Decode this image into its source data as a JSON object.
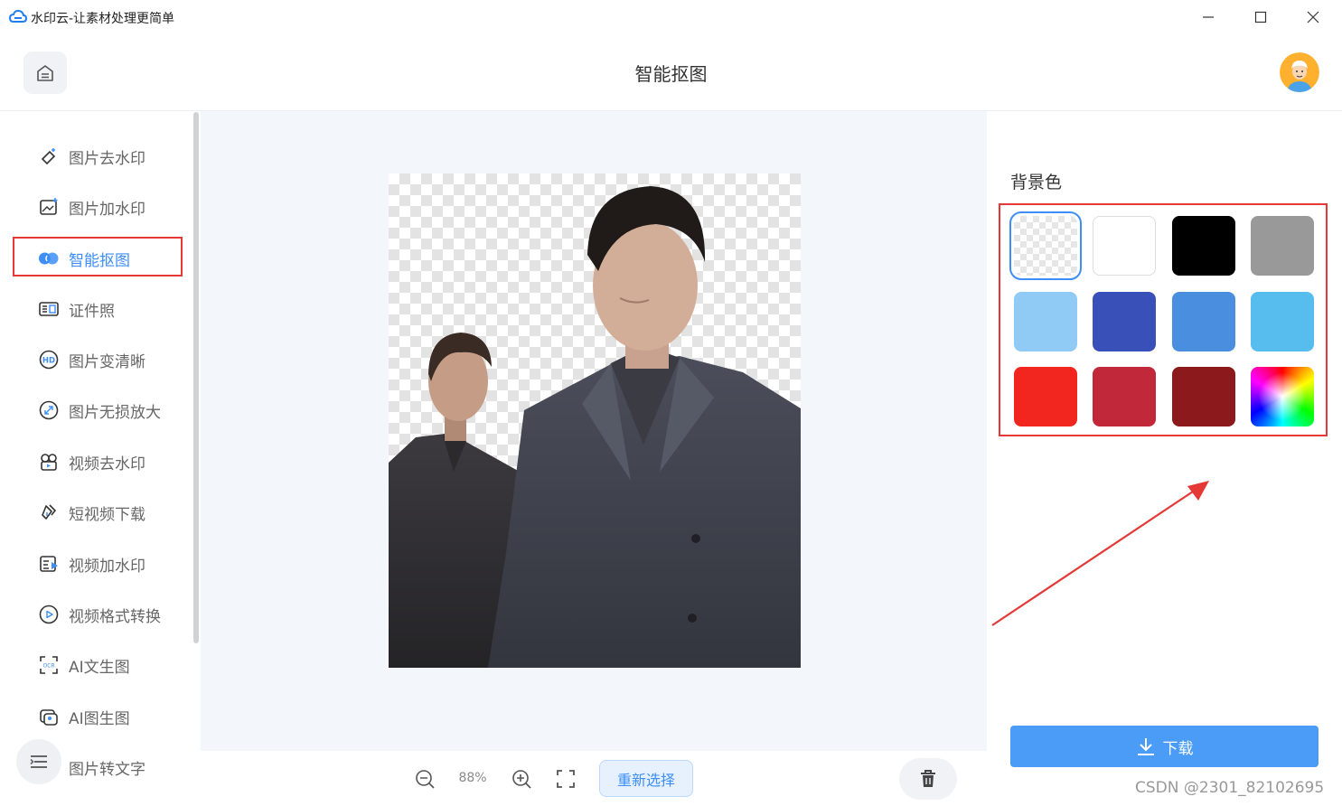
{
  "window": {
    "title": "水印云-让素材处理更简单",
    "controls": [
      "minimize",
      "maximize",
      "close"
    ]
  },
  "header": {
    "page_title": "智能抠图"
  },
  "sidebar": {
    "items": [
      {
        "label": "图片去水印",
        "icon": "eraser-icon"
      },
      {
        "label": "图片加水印",
        "icon": "image-add-icon"
      },
      {
        "label": "智能抠图",
        "icon": "cutout-icon",
        "active": true
      },
      {
        "label": "证件照",
        "icon": "id-card-icon"
      },
      {
        "label": "图片变清晰",
        "icon": "hd-icon"
      },
      {
        "label": "图片无损放大",
        "icon": "enlarge-icon"
      },
      {
        "label": "视频去水印",
        "icon": "video-eraser-icon"
      },
      {
        "label": "短视频下载",
        "icon": "link-download-icon"
      },
      {
        "label": "视频加水印",
        "icon": "video-add-icon"
      },
      {
        "label": "视频格式转换",
        "icon": "play-circle-icon"
      },
      {
        "label": "AI文生图",
        "icon": "ocr-frame-icon"
      },
      {
        "label": "AI图生图",
        "icon": "image-stack-icon"
      },
      {
        "label": "图片转文字",
        "icon": "text-icon"
      }
    ]
  },
  "toolbar": {
    "zoom_value": "88%",
    "reselect_label": "重新选择"
  },
  "right_panel": {
    "bg_label": "背景色",
    "swatches": [
      {
        "name": "transparent",
        "color": "transparent",
        "selected": true
      },
      {
        "name": "white",
        "color": "#ffffff"
      },
      {
        "name": "black",
        "color": "#000000"
      },
      {
        "name": "gray",
        "color": "#999999"
      },
      {
        "name": "light-blue",
        "color": "#90cbf5"
      },
      {
        "name": "royal-blue",
        "color": "#3a50b9"
      },
      {
        "name": "medium-blue",
        "color": "#4a8fdf"
      },
      {
        "name": "sky-blue",
        "color": "#57bcee"
      },
      {
        "name": "red",
        "color": "#f3261f"
      },
      {
        "name": "crimson",
        "color": "#c1283a"
      },
      {
        "name": "dark-red",
        "color": "#8c1a1d"
      },
      {
        "name": "custom-spectrum",
        "color": "spectrum"
      }
    ],
    "download_label": "下载"
  },
  "watermark": "CSDN @2301_82102695",
  "colors": {
    "accent": "#3d8ef7",
    "highlight_box": "#e53935",
    "canvas_bg": "#f3f6fb",
    "download_button": "#4a9cf6"
  }
}
